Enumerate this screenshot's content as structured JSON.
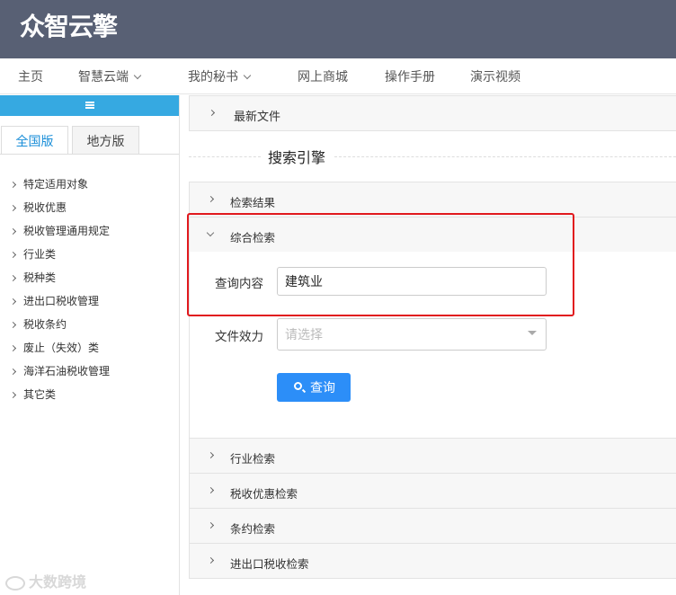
{
  "header": {
    "logo_text": "众智云擎"
  },
  "nav": {
    "items": [
      {
        "label": "主页",
        "dropdown": false
      },
      {
        "label": "智慧云端",
        "dropdown": true
      },
      {
        "label": "我的秘书",
        "dropdown": true
      },
      {
        "label": "网上商城",
        "dropdown": false
      },
      {
        "label": "操作手册",
        "dropdown": false
      },
      {
        "label": "演示视频",
        "dropdown": false
      }
    ]
  },
  "sidebar": {
    "menu_icon": "hamburger-icon",
    "tabs": [
      {
        "label": "全国版",
        "active": true
      },
      {
        "label": "地方版",
        "active": false
      }
    ],
    "items": [
      "特定适用对象",
      "税收优惠",
      "税收管理通用规定",
      "行业类",
      "税种类",
      "进出口税收管理",
      "税收条约",
      "废止（失效）类",
      "海洋石油税收管理",
      "其它类"
    ]
  },
  "main": {
    "latest_files": "最新文件",
    "search_engine_title": "搜索引擎",
    "results": "检索结果",
    "combined_search": {
      "title": "综合检索",
      "expanded": true,
      "query_label": "查询内容",
      "query_value": "建筑业",
      "effect_label": "文件效力",
      "effect_placeholder": "请选择",
      "button_label": "查询",
      "button_icon": "search-icon"
    },
    "sections": [
      "行业检索",
      "税收优惠检索",
      "条约检索",
      "进出口税收检索"
    ]
  },
  "colors": {
    "header_bg": "#586074",
    "sidebar_accent": "#36a9e1",
    "primary_button": "#2c8ef8",
    "highlight_border": "#e1191e"
  },
  "watermark": {
    "text": "大数跨境"
  }
}
